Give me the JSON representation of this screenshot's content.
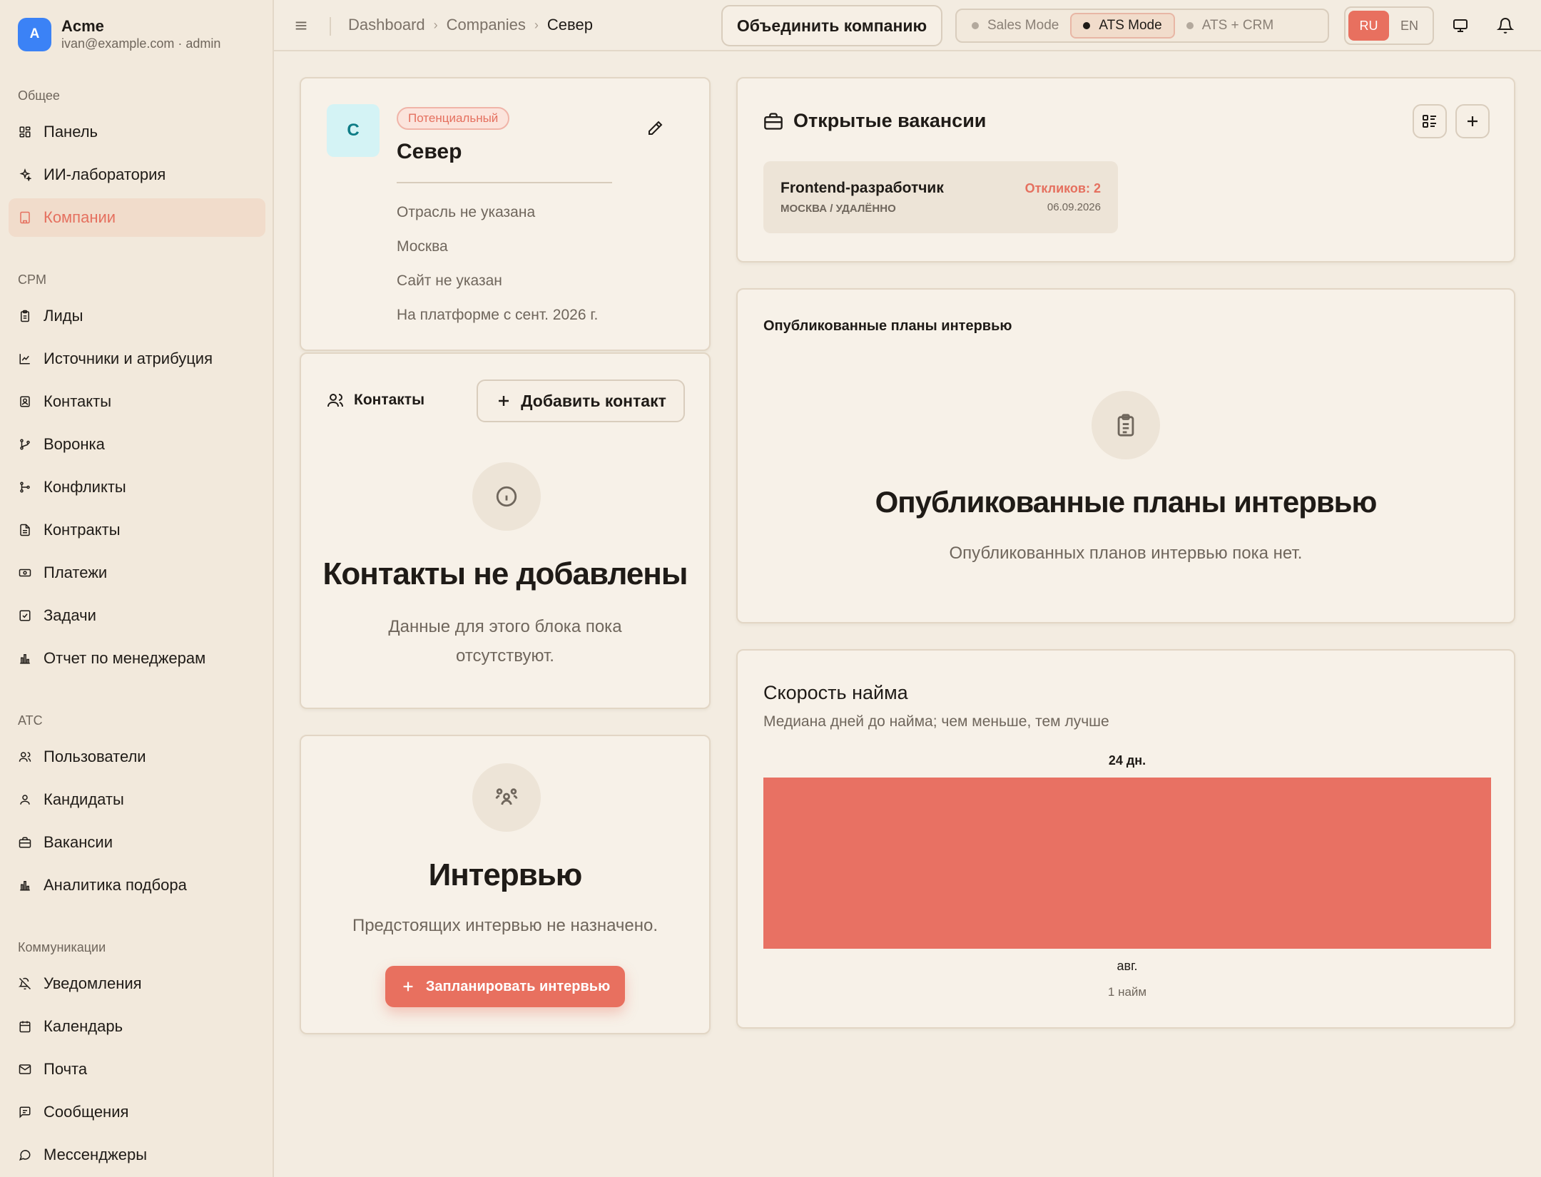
{
  "account": {
    "avatar_letter": "A",
    "name": "Acme",
    "subtitle": "ivan@example.com · admin"
  },
  "sidebar": {
    "groups": [
      {
        "heading": "Общее",
        "items": [
          {
            "label": "Панель",
            "icon": "dashboard-icon"
          },
          {
            "label": "ИИ-лаборатория",
            "icon": "sparkles-icon"
          },
          {
            "label": "Компании",
            "icon": "building-icon",
            "active": true
          }
        ]
      },
      {
        "heading": "CPM",
        "items": [
          {
            "label": "Лиды",
            "icon": "clipboard-icon"
          },
          {
            "label": "Источники и атрибуция",
            "icon": "chart-line-icon"
          },
          {
            "label": "Контакты",
            "icon": "contact-icon"
          },
          {
            "label": "Воронка",
            "icon": "funnel-icon"
          },
          {
            "label": "Конфликты",
            "icon": "branch-icon"
          },
          {
            "label": "Контракты",
            "icon": "file-icon"
          },
          {
            "label": "Платежи",
            "icon": "banknote-icon"
          },
          {
            "label": "Задачи",
            "icon": "checkbox-icon"
          },
          {
            "label": "Отчет по менеджерам",
            "icon": "bar-chart-icon"
          }
        ]
      },
      {
        "heading": "ATC",
        "items": [
          {
            "label": "Пользователи",
            "icon": "users-icon"
          },
          {
            "label": "Кандидаты",
            "icon": "user-icon"
          },
          {
            "label": "Вакансии",
            "icon": "briefcase-icon"
          },
          {
            "label": "Аналитика подбора",
            "icon": "bar-chart-icon"
          }
        ]
      },
      {
        "heading": "Коммуникации",
        "items": [
          {
            "label": "Уведомления",
            "icon": "bell-off-icon"
          },
          {
            "label": "Календарь",
            "icon": "calendar-icon"
          },
          {
            "label": "Почта",
            "icon": "mail-icon"
          },
          {
            "label": "Сообщения",
            "icon": "message-square-icon"
          },
          {
            "label": "Мессенджеры",
            "icon": "message-circle-icon"
          }
        ]
      }
    ]
  },
  "topbar": {
    "breadcrumbs": [
      "Dashboard",
      "Companies",
      "Север"
    ],
    "merge_button": "Объединить компанию",
    "modes": [
      {
        "label": "Sales Mode",
        "active": false
      },
      {
        "label": "ATS Mode",
        "active": true
      },
      {
        "label": "ATS + CRM",
        "active": false
      }
    ],
    "languages": [
      {
        "label": "RU",
        "active": true
      },
      {
        "label": "EN",
        "active": false
      }
    ]
  },
  "company": {
    "avatar_letter": "С",
    "status": "Потенциальный",
    "name": "Север",
    "industry": "Отрасль не указана",
    "city": "Москва",
    "website": "Сайт не указан",
    "since": "На платформе с сент. 2026 г."
  },
  "contacts": {
    "title": "Контакты",
    "add_button": "Добавить контакт",
    "empty_title": "Контакты не добавлены",
    "empty_text": "Данные для этого блока пока отсутствуют."
  },
  "interviews": {
    "empty_title": "Интервью",
    "empty_text": "Предстоящих интервью не назначено.",
    "schedule_button": "Запланировать интервью"
  },
  "vacancies": {
    "title": "Открытые вакансии",
    "items": [
      {
        "title": "Frontend-разработчик",
        "location": "МОСКВА / УДАЛЁННО",
        "responses": "Откликов: 2",
        "date": "06.09.2026"
      }
    ]
  },
  "interview_plans": {
    "title": "Опубликованные планы интервью",
    "empty_title": "Опубликованные планы интервью",
    "empty_text": "Опубликованных планов интервью пока нет."
  },
  "hiring_speed": {
    "title": "Скорость найма",
    "subtitle": "Медиана дней до найма; чем меньше, тем лучше"
  },
  "chart_data": {
    "type": "bar",
    "categories": [
      "авг."
    ],
    "values": [
      24
    ],
    "value_labels": [
      "24 дн."
    ],
    "sub_labels": [
      "1 найм"
    ],
    "ylim": [
      0,
      24
    ],
    "color": "#e87163",
    "grid": false,
    "legend": "none"
  },
  "colors": {
    "accent": "#e8705f",
    "background": "#f3ece1",
    "brand_blue": "#3b82f6",
    "card": "#f7f1e8"
  }
}
